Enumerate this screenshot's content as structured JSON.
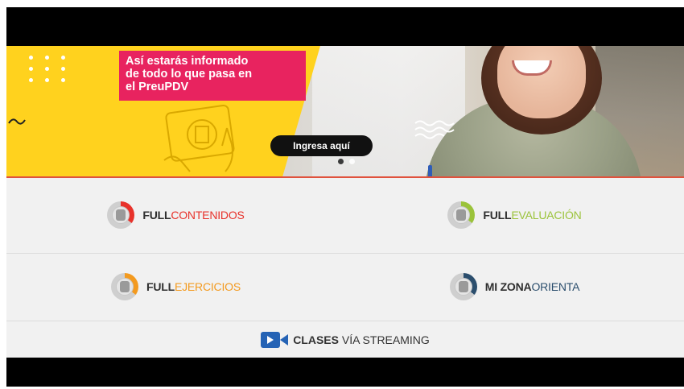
{
  "banner": {
    "headline_lines": [
      "Así estarás informado",
      "de todo lo que pasa en",
      "el PreuPDV"
    ],
    "cta_label": "Ingresa aquí",
    "carousel": {
      "count": 2,
      "active_index": 0
    }
  },
  "menu": {
    "items": [
      {
        "prefix": "FULL",
        "suffix": "CONTENIDOS",
        "accent": "#e8322b",
        "icon": "full-contenidos-icon"
      },
      {
        "prefix": "FULL",
        "suffix": "EVALUACIÓN",
        "accent": "#9bc33b",
        "icon": "full-evaluacion-icon"
      },
      {
        "prefix": "FULL",
        "suffix": "EJERCICIOS",
        "accent": "#f39a1f",
        "icon": "full-ejercicios-icon"
      },
      {
        "prefix": "MI ZONA",
        "suffix": "ORIENTA",
        "accent": "#2b4e6d",
        "icon": "mi-zona-orienta-icon"
      }
    ],
    "streaming": {
      "prefix": "CLASES",
      "suffix": " VÍA STREAMING",
      "accent": "#2563b5",
      "icon": "video-camera-icon"
    }
  }
}
